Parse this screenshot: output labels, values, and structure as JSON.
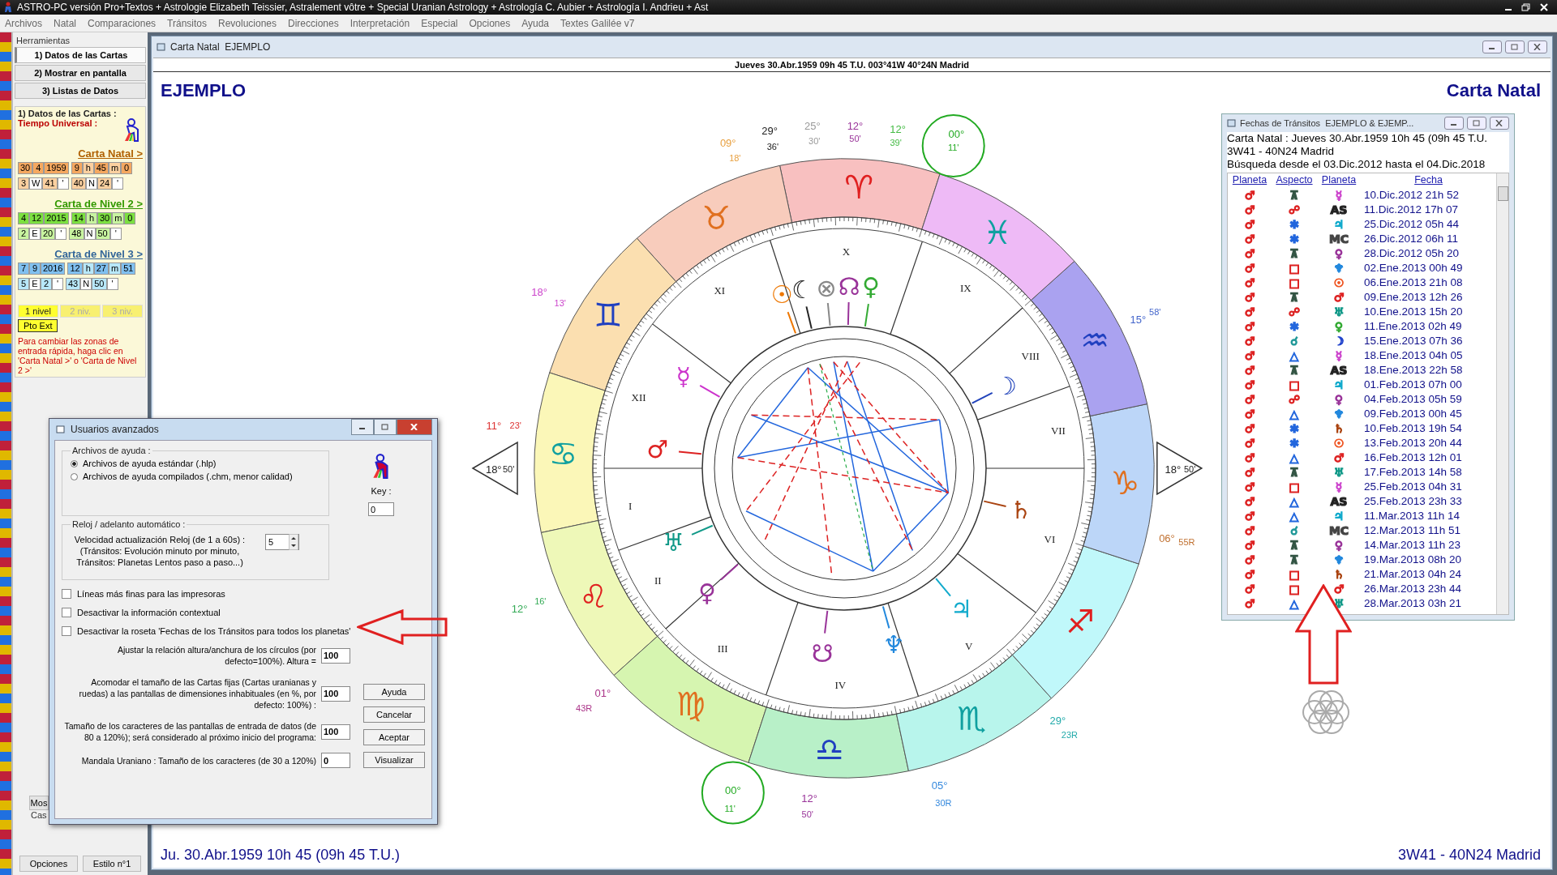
{
  "window": {
    "title": "ASTRO-PC versión Pro+Textos + Astrologie Elizabeth Teissier, Astralement vôtre + Special Uranian Astrology + Astrología C. Aubier + Astrología I. Andrieu + Ast"
  },
  "menu": [
    "Archivos",
    "Natal",
    "Comparaciones",
    "Tránsitos",
    "Revoluciones",
    "Direcciones",
    "Interpretación",
    "Especial",
    "Opciones",
    "Ayuda",
    "Textes Galilée v7"
  ],
  "sidebar": {
    "title": "Herramientas",
    "tools": [
      {
        "label": "1) Datos de las Cartas",
        "selected": true
      },
      {
        "label": "2) Mostrar en pantalla",
        "selected": false
      },
      {
        "label": "3) Listas de Datos",
        "selected": false
      }
    ],
    "group_title": "1) Datos de las Cartas :",
    "ut_label": "Tiempo Universal :",
    "charts": [
      {
        "link": "Carta Natal >",
        "date": [
          "30",
          "4",
          "1959"
        ],
        "time": [
          "9",
          "h",
          "45",
          "m",
          "0"
        ],
        "lon": [
          "3",
          "W",
          "41",
          "'"
        ],
        "lat": [
          "40",
          "N",
          "24",
          "'"
        ]
      },
      {
        "link": "Carta de Nivel 2 >",
        "date": [
          "4",
          "12",
          "2015"
        ],
        "time": [
          "14",
          "h",
          "30",
          "m",
          "0"
        ],
        "lon": [
          "2",
          "E",
          "20",
          "'"
        ],
        "lat": [
          "48",
          "N",
          "50",
          "'"
        ]
      },
      {
        "link": "Carta de Nivel 3 >",
        "date": [
          "7",
          "9",
          "2016"
        ],
        "time": [
          "12",
          "h",
          "27",
          "m",
          "51"
        ],
        "lon": [
          "5",
          "E",
          "2",
          "'"
        ],
        "lat": [
          "43",
          "N",
          "50",
          "'"
        ]
      }
    ],
    "levels": [
      {
        "label": "1 nivel",
        "selected": true
      },
      {
        "label": "2 niv.",
        "selected": false
      },
      {
        "label": "3 niv.",
        "selected": false
      }
    ],
    "ext_button": "Pto Ext",
    "hint": "Para cambiar las zonas de entrada rápida, haga clic en 'Carta Natal >' o 'Carta de Nivel 2 >'",
    "covered_button": "Mos",
    "covered_text": "Cas",
    "bottom_buttons": [
      "Opciones",
      "Estilo n°1"
    ]
  },
  "chart_window": {
    "title": "Carta Natal  EJEMPLO",
    "header": "Jueves 30.Abr.1959 09h 45 T.U. 003°41W 40°24N  Madrid",
    "name": "EJEMPLO",
    "chart_type": "Carta Natal",
    "footer_left": "Ju. 30.Abr.1959 10h 45 (09h 45 T.U.)",
    "footer_right": "3W41 - 40N24  Madrid",
    "wheel": {
      "signs": [
        "♈",
        "♉",
        "♊",
        "♋",
        "♌",
        "♍",
        "♎",
        "♏",
        "♐",
        "♑",
        "♒",
        "♓"
      ],
      "houses": [
        "I",
        "II",
        "III",
        "IV",
        "V",
        "VI",
        "VII",
        "VIII",
        "IX",
        "X",
        "XI",
        "XII"
      ],
      "planets": [
        {
          "glyph": "☉",
          "color": "#ee7700"
        },
        {
          "glyph": "☾",
          "color": "#222222"
        },
        {
          "glyph": "⊗",
          "color": "#888888"
        },
        {
          "glyph": "☊",
          "color": "#993399"
        },
        {
          "glyph": "♀",
          "color": "#33aa33"
        },
        {
          "glyph": "☿",
          "color": "#cc33cc"
        },
        {
          "glyph": "♂",
          "color": "#dd2222"
        },
        {
          "glyph": "♅",
          "color": "#119988"
        },
        {
          "glyph": "♀",
          "color": "#993399"
        },
        {
          "glyph": "☋",
          "color": "#993399"
        },
        {
          "glyph": "♆",
          "color": "#2288dd"
        },
        {
          "glyph": "♃",
          "color": "#11aacc"
        },
        {
          "glyph": "♄",
          "color": "#aa4411"
        },
        {
          "glyph": "☽",
          "color": "#2244bb"
        }
      ],
      "degree_labels": [
        {
          "deg": "09°",
          "min": "18'",
          "color": "#e8a040"
        },
        {
          "deg": "29°",
          "min": "36'",
          "color": "#222222"
        },
        {
          "deg": "25°",
          "min": "30'",
          "color": "#999999"
        },
        {
          "deg": "12°",
          "min": "50'",
          "color": "#993399"
        },
        {
          "deg": "12°",
          "min": "39'",
          "color": "#44bb44"
        },
        {
          "deg": "00°",
          "min": "11'",
          "color": "#22aa22"
        },
        {
          "deg": "15°",
          "min": "58'",
          "color": "#4466cc"
        },
        {
          "deg": "18°",
          "min": "50'",
          "color": "#222222"
        },
        {
          "deg": "06°",
          "min": "55R",
          "color": "#c07030"
        },
        {
          "deg": "29°",
          "min": "23R",
          "color": "#22aaaa"
        },
        {
          "deg": "05°",
          "min": "30R",
          "color": "#3388dd"
        },
        {
          "deg": "12°",
          "min": "50'",
          "color": "#993399"
        },
        {
          "deg": "00°",
          "min": "11'",
          "color": "#22aa22"
        },
        {
          "deg": "01°",
          "min": "43R",
          "color": "#aa3388"
        },
        {
          "deg": "12°",
          "min": "16'",
          "color": "#33aa55"
        },
        {
          "deg": "11°",
          "min": "23'",
          "color": "#dd3333"
        },
        {
          "deg": "18°",
          "min": "50'",
          "color": "#222222"
        },
        {
          "deg": "18°",
          "min": "13'",
          "color": "#cc44cc"
        }
      ]
    }
  },
  "transits_window": {
    "title": "Fechas de Tránsitos  EJEMPLO & EJEMP...",
    "info": [
      "Carta Natal : Jueves 30.Abr.1959 10h 45 (09h 45 T.U.",
      "3W41 - 40N24  Madrid",
      "Búsqueda desde el 03.Dic.2012 hasta el 04.Dic.2018"
    ],
    "columns": [
      "Planeta",
      "Aspecto",
      "Planeta",
      "Fecha"
    ],
    "rows": [
      {
        "planet": "♂",
        "aspect": {
          "glyph": "⊼",
          "color": "#335544"
        },
        "planet2": {
          "glyph": "☿",
          "color": "#cc44cc"
        },
        "date": "10.Dic.2012 21h 52"
      },
      {
        "planet": "♂",
        "aspect": {
          "glyph": "☍",
          "color": "#dd2222"
        },
        "planet2": {
          "glyph": "AS",
          "color": "#222222"
        },
        "date": "11.Dic.2012 17h 07"
      },
      {
        "planet": "♂",
        "aspect": {
          "glyph": "✱",
          "color": "#2266dd"
        },
        "planet2": {
          "glyph": "♃",
          "color": "#11aacc"
        },
        "date": "25.Dic.2012 05h 44"
      },
      {
        "planet": "♂",
        "aspect": {
          "glyph": "✱",
          "color": "#2266dd"
        },
        "planet2": {
          "glyph": "MC",
          "color": "#444444"
        },
        "date": "26.Dic.2012 06h 11"
      },
      {
        "planet": "♂",
        "aspect": {
          "glyph": "⊼",
          "color": "#335544"
        },
        "planet2": {
          "glyph": "♀",
          "color": "#993399"
        },
        "date": "28.Dic.2012 05h 20"
      },
      {
        "planet": "♂",
        "aspect": {
          "glyph": "□",
          "color": "#dd2222"
        },
        "planet2": {
          "glyph": "♆",
          "color": "#2288dd"
        },
        "date": "02.Ene.2013 00h 49"
      },
      {
        "planet": "♂",
        "aspect": {
          "glyph": "□",
          "color": "#dd2222"
        },
        "planet2": {
          "glyph": "☉",
          "color": "#ee5522"
        },
        "date": "06.Ene.2013 21h 08"
      },
      {
        "planet": "♂",
        "aspect": {
          "glyph": "⊼",
          "color": "#335544"
        },
        "planet2": {
          "glyph": "♂",
          "color": "#dd2222"
        },
        "date": "09.Ene.2013 12h 26"
      },
      {
        "planet": "♂",
        "aspect": {
          "glyph": "☍",
          "color": "#dd2222"
        },
        "planet2": {
          "glyph": "♅",
          "color": "#119988"
        },
        "date": "10.Ene.2013 15h 20"
      },
      {
        "planet": "♂",
        "aspect": {
          "glyph": "✱",
          "color": "#2266dd"
        },
        "planet2": {
          "glyph": "♀",
          "color": "#33aa33"
        },
        "date": "11.Ene.2013 02h 49"
      },
      {
        "planet": "♂",
        "aspect": {
          "glyph": "☌",
          "color": "#229999"
        },
        "planet2": {
          "glyph": "☽",
          "color": "#2244cc"
        },
        "date": "15.Ene.2013 07h 36"
      },
      {
        "planet": "♂",
        "aspect": {
          "glyph": "△",
          "color": "#2266dd"
        },
        "planet2": {
          "glyph": "☿",
          "color": "#cc44cc"
        },
        "date": "18.Ene.2013 04h 05"
      },
      {
        "planet": "♂",
        "aspect": {
          "glyph": "⊼",
          "color": "#335544"
        },
        "planet2": {
          "glyph": "AS",
          "color": "#222222"
        },
        "date": "18.Ene.2013 22h 58"
      },
      {
        "planet": "♂",
        "aspect": {
          "glyph": "□",
          "color": "#dd2222"
        },
        "planet2": {
          "glyph": "♃",
          "color": "#11aacc"
        },
        "date": "01.Feb.2013 07h 00"
      },
      {
        "planet": "♂",
        "aspect": {
          "glyph": "☍",
          "color": "#dd2222"
        },
        "planet2": {
          "glyph": "♀",
          "color": "#993399"
        },
        "date": "04.Feb.2013 05h 59"
      },
      {
        "planet": "♂",
        "aspect": {
          "glyph": "△",
          "color": "#2266dd"
        },
        "planet2": {
          "glyph": "♆",
          "color": "#2288dd"
        },
        "date": "09.Feb.2013 00h 45"
      },
      {
        "planet": "♂",
        "aspect": {
          "glyph": "✱",
          "color": "#2266dd"
        },
        "planet2": {
          "glyph": "♄",
          "color": "#aa4411"
        },
        "date": "10.Feb.2013 19h 54"
      },
      {
        "planet": "♂",
        "aspect": {
          "glyph": "✱",
          "color": "#2266dd"
        },
        "planet2": {
          "glyph": "☉",
          "color": "#ee5522"
        },
        "date": "13.Feb.2013 20h 44"
      },
      {
        "planet": "♂",
        "aspect": {
          "glyph": "△",
          "color": "#2266dd"
        },
        "planet2": {
          "glyph": "♂",
          "color": "#dd2222"
        },
        "date": "16.Feb.2013 12h 01"
      },
      {
        "planet": "♂",
        "aspect": {
          "glyph": "⊼",
          "color": "#335544"
        },
        "planet2": {
          "glyph": "♅",
          "color": "#119988"
        },
        "date": "17.Feb.2013 14h 58"
      },
      {
        "planet": "♂",
        "aspect": {
          "glyph": "□",
          "color": "#dd2222"
        },
        "planet2": {
          "glyph": "☿",
          "color": "#cc44cc"
        },
        "date": "25.Feb.2013 04h 31"
      },
      {
        "planet": "♂",
        "aspect": {
          "glyph": "△",
          "color": "#2266dd"
        },
        "planet2": {
          "glyph": "AS",
          "color": "#222222"
        },
        "date": "25.Feb.2013 23h 33"
      },
      {
        "planet": "♂",
        "aspect": {
          "glyph": "△",
          "color": "#2266dd"
        },
        "planet2": {
          "glyph": "♃",
          "color": "#11aacc"
        },
        "date": "11.Mar.2013 11h 14"
      },
      {
        "planet": "♂",
        "aspect": {
          "glyph": "☌",
          "color": "#229999"
        },
        "planet2": {
          "glyph": "MC",
          "color": "#444444"
        },
        "date": "12.Mar.2013 11h 51"
      },
      {
        "planet": "♂",
        "aspect": {
          "glyph": "⊼",
          "color": "#335544"
        },
        "planet2": {
          "glyph": "♀",
          "color": "#993399"
        },
        "date": "14.Mar.2013 11h 23"
      },
      {
        "planet": "♂",
        "aspect": {
          "glyph": "⊼",
          "color": "#335544"
        },
        "planet2": {
          "glyph": "♆",
          "color": "#2288dd"
        },
        "date": "19.Mar.2013 08h 20"
      },
      {
        "planet": "♂",
        "aspect": {
          "glyph": "□",
          "color": "#dd2222"
        },
        "planet2": {
          "glyph": "♄",
          "color": "#aa4411"
        },
        "date": "21.Mar.2013 04h 24"
      },
      {
        "planet": "♂",
        "aspect": {
          "glyph": "□",
          "color": "#dd2222"
        },
        "planet2": {
          "glyph": "♂",
          "color": "#dd2222"
        },
        "date": "26.Mar.2013 23h 44"
      },
      {
        "planet": "♂",
        "aspect": {
          "glyph": "△",
          "color": "#2266dd"
        },
        "planet2": {
          "glyph": "♅",
          "color": "#119988"
        },
        "date": "28.Mar.2013 03h 21"
      }
    ]
  },
  "dialog": {
    "title": "Usuarios avanzados",
    "help_group": {
      "title": "Archivos de ayuda :",
      "options": [
        {
          "label": "Archivos de ayuda estándar (.hlp)",
          "selected": true
        },
        {
          "label": "Archivos de ayuda compilados (.chm, menor calidad)",
          "selected": false
        }
      ]
    },
    "key": {
      "label": "Key :",
      "value": "0"
    },
    "clock_group": {
      "title": "Reloj / adelanto automático :",
      "text": "Velocidad actualización Reloj (de 1 a 60s) :\n(Tránsitos: Evolución minuto por minuto,\nTránsitos: Planetas Lentos paso a paso...)",
      "value": "5"
    },
    "checkboxes": [
      {
        "label": "Líneas más finas para las impresoras",
        "checked": false
      },
      {
        "label": "Desactivar la información contextual",
        "checked": false
      },
      {
        "label": "Desactivar la roseta 'Fechas de los Tránsitos para todos los planetas'",
        "checked": false
      }
    ],
    "settings": [
      {
        "label": "Ajustar la relación altura/anchura de los círculos (por defecto=100%). Altura =",
        "value": "100"
      },
      {
        "label": "Acomodar el tamaño de las Cartas fijas (Cartas uranianas y ruedas) a las pantallas de dimensiones inhabituales (en %, por defecto: 100%) :",
        "value": "100"
      },
      {
        "label": "Tamaño de los caracteres de las pantallas de entrada de datos (de 80 a 120%); será considerado al próximo inicio del programa:",
        "value": "100"
      },
      {
        "label": "Mandala Uraniano : Tamaño de los caracteres (de 30 a 120%)",
        "value": "0"
      }
    ],
    "buttons": [
      "Ayuda",
      "Cancelar",
      "Aceptar",
      "Visualizar"
    ]
  }
}
